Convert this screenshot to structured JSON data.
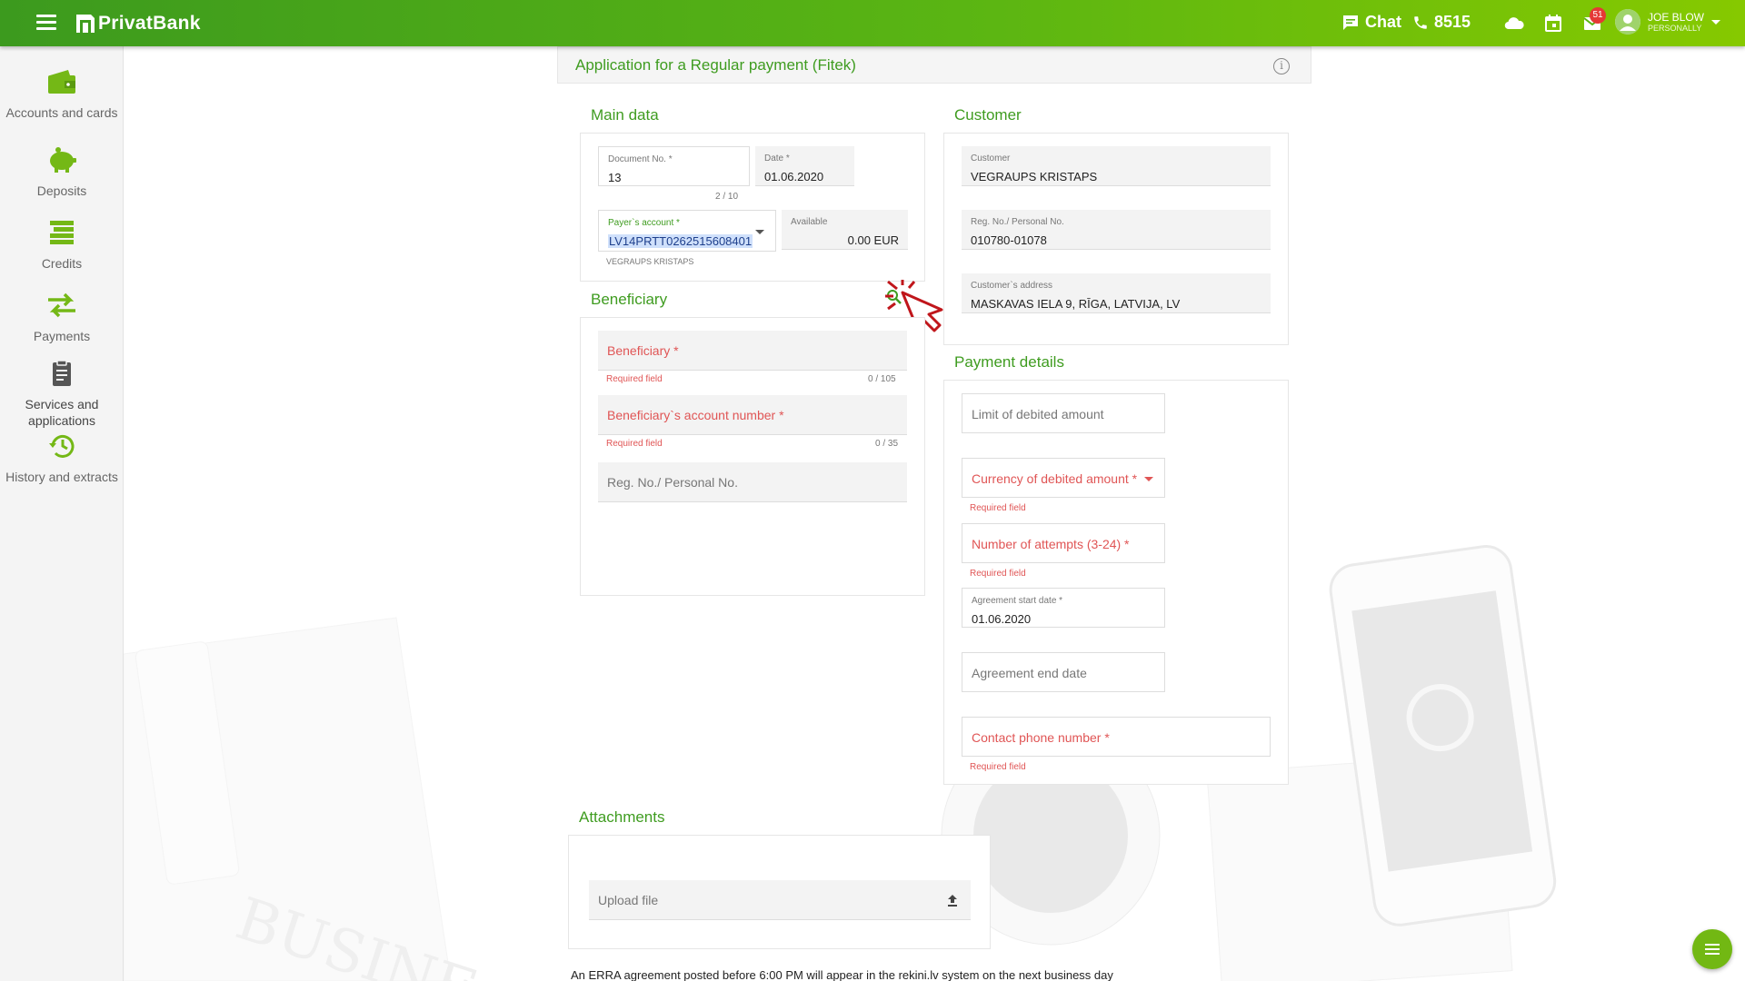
{
  "header": {
    "brand": "PrivatBank",
    "chat_label": "Chat",
    "phone_label": "8515",
    "mail_badge": "51",
    "user_name": "JOE BLOW",
    "user_role": "PERSONALLY"
  },
  "sidebar": {
    "items": [
      {
        "label": "Accounts and cards",
        "icon": "wallet-icon"
      },
      {
        "label": "Deposits",
        "icon": "piggy-bank-icon"
      },
      {
        "label": "Credits",
        "icon": "credits-icon"
      },
      {
        "label": "Payments",
        "icon": "transfer-arrows-icon"
      },
      {
        "label": "Services and applications",
        "icon": "clipboard-icon"
      },
      {
        "label": "History and extracts",
        "icon": "history-icon"
      }
    ]
  },
  "page": {
    "title": "Application for a Regular payment (Fitek)"
  },
  "main_data": {
    "section_title": "Main data",
    "document_no_label": "Document No. *",
    "document_no_value": "13",
    "document_counter": "2 / 10",
    "date_label": "Date *",
    "date_value": "01.06.2020",
    "payer_account_label": "Payer`s account *",
    "payer_account_value": "LV14PRTT0262515608401",
    "payer_account_owner": "VEGRAUPS KRISTAPS",
    "available_label": "Available",
    "available_value": "0.00 EUR"
  },
  "customer": {
    "section_title": "Customer",
    "customer_label": "Customer",
    "customer_value": "VEGRAUPS KRISTAPS",
    "reg_label": "Reg. No./ Personal No.",
    "reg_value": "010780-01078",
    "address_label": "Customer`s address",
    "address_value": "MASKAVAS IELA 9, RĪGA, LATVIJA, LV"
  },
  "beneficiary": {
    "section_title": "Beneficiary",
    "name_placeholder": "Beneficiary *",
    "name_hint": "Required field",
    "name_counter": "0 / 105",
    "account_placeholder": "Beneficiary`s account number *",
    "account_hint": "Required field",
    "account_counter": "0 / 35",
    "reg_placeholder": "Reg. No./ Personal No."
  },
  "payment_details": {
    "section_title": "Payment details",
    "limit_placeholder": "Limit of debited amount",
    "currency_placeholder": "Currency of debited amount *",
    "currency_hint": "Required field",
    "attempts_placeholder": "Number of attempts (3-24) *",
    "attempts_hint": "Required field",
    "start_date_label": "Agreement start date *",
    "start_date_value": "01.06.2020",
    "end_date_placeholder": "Agreement end date",
    "phone_placeholder": "Contact phone number *",
    "phone_hint": "Required field"
  },
  "attachments": {
    "section_title": "Attachments",
    "upload_label": "Upload file"
  },
  "footer_note": "An ERRA agreement posted before 6:00 PM will appear in the rekini.lv system on the next business day",
  "colors": {
    "brand_green": "#3f9c20",
    "required_red": "#e05555",
    "header_gradient_start": "#3c9a1e",
    "header_gradient_end": "#86c900"
  }
}
